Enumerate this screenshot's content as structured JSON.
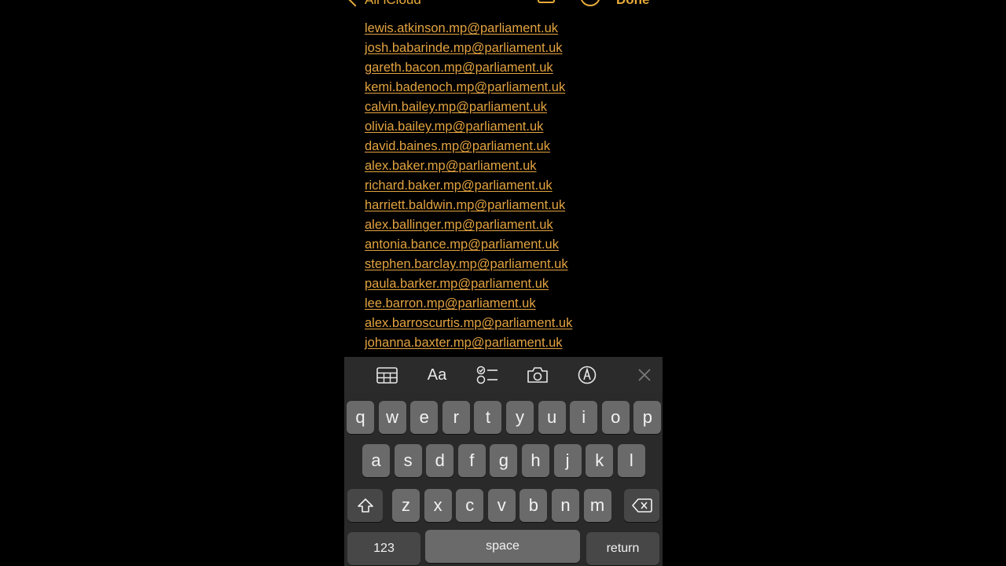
{
  "nav": {
    "back_label": "All iCloud",
    "done_label": "Done"
  },
  "emails": [
    "lewis.atkinson.mp@parliament.uk",
    "josh.babarinde.mp@parliament.uk",
    "gareth.bacon.mp@parliament.uk",
    "kemi.badenoch.mp@parliament.uk",
    "calvin.bailey.mp@parliament.uk",
    "olivia.bailey.mp@parliament.uk",
    "david.baines.mp@parliament.uk",
    "alex.baker.mp@parliament.uk",
    "richard.baker.mp@parliament.uk",
    "harriett.baldwin.mp@parliament.uk",
    "alex.ballinger.mp@parliament.uk",
    "antonia.bance.mp@parliament.uk",
    "stephen.barclay.mp@parliament.uk",
    "paula.barker.mp@parliament.uk",
    "lee.barron.mp@parliament.uk",
    "alex.barroscurtis.mp@parliament.uk",
    "johanna.baxter.mp@parliament.uk"
  ],
  "toolbar": {
    "format_label": "Aa",
    "icons": [
      "table-icon",
      "format-text-icon",
      "checklist-icon",
      "camera-icon",
      "markup-pen-icon",
      "close-icon"
    ]
  },
  "keyboard": {
    "row1": [
      "q",
      "w",
      "e",
      "r",
      "t",
      "y",
      "u",
      "i",
      "o",
      "p"
    ],
    "row2": [
      "a",
      "s",
      "d",
      "f",
      "g",
      "h",
      "j",
      "k",
      "l"
    ],
    "row3": [
      "z",
      "x",
      "c",
      "v",
      "b",
      "n",
      "m"
    ],
    "numbers_label": "123",
    "space_label": "space",
    "return_label": "return"
  },
  "colors": {
    "accent": "#e3a340",
    "background": "#000000",
    "keyboard_bg": "#2a2a2a",
    "key_bg": "#6a6a6a",
    "key_dark_bg": "#474747"
  }
}
